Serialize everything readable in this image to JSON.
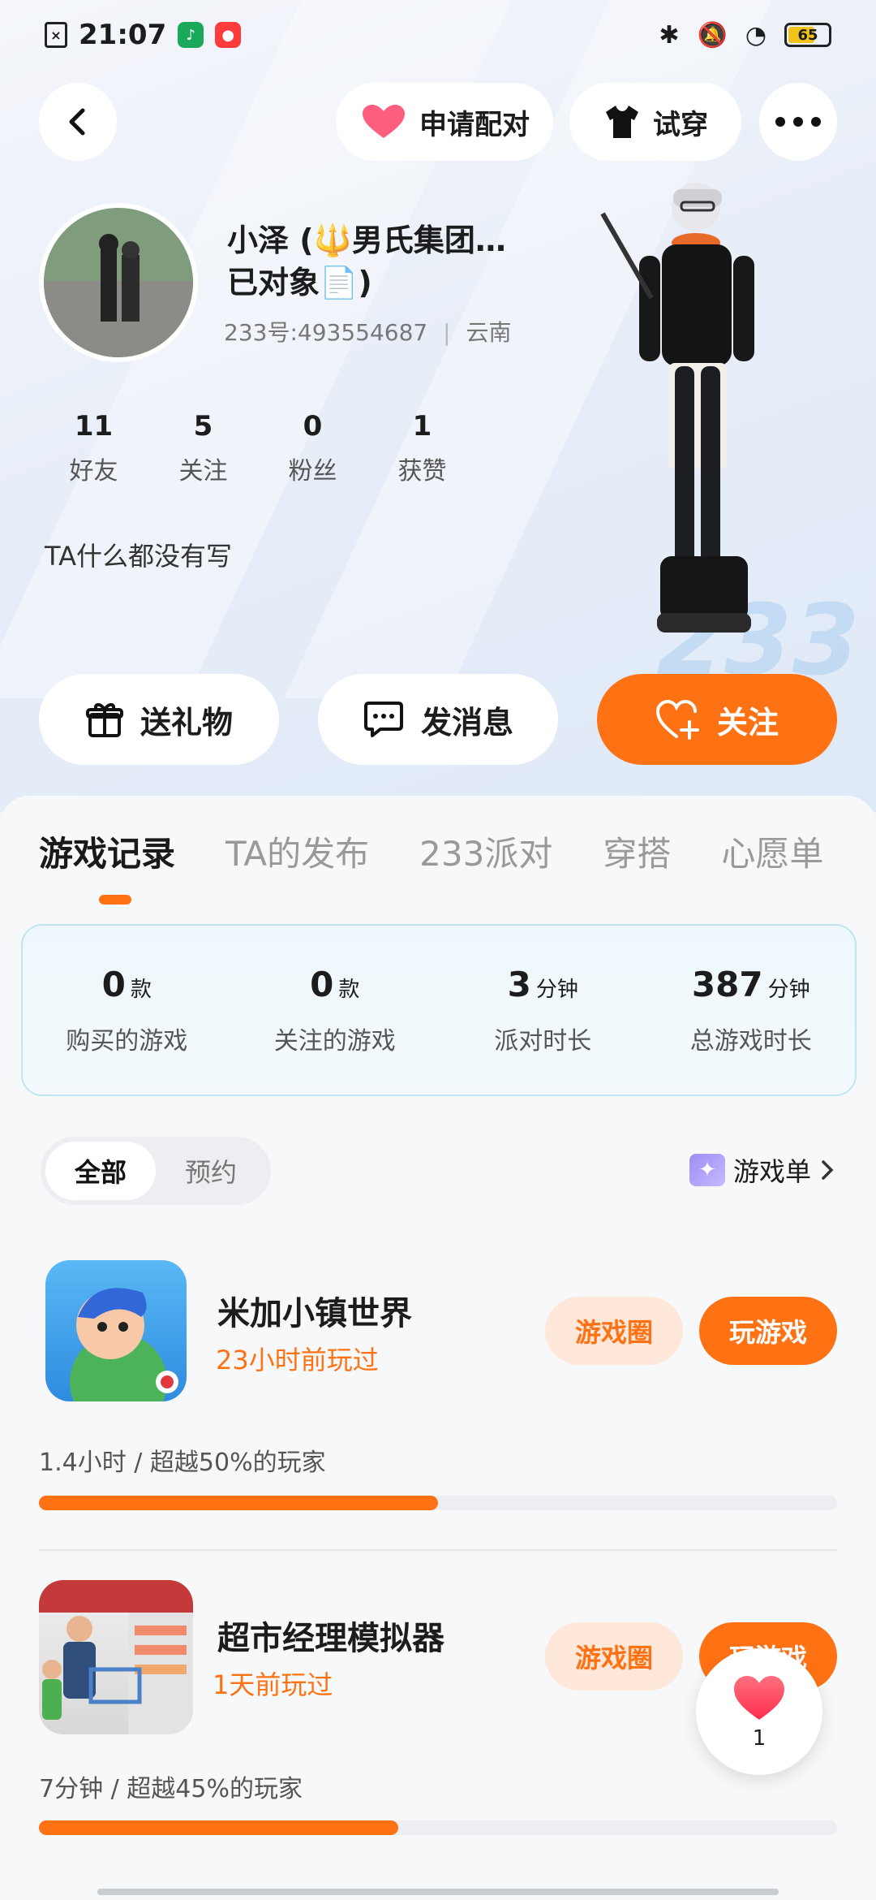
{
  "status_bar": {
    "time": "21:07",
    "battery": "65"
  },
  "top_actions": {
    "pair_label": "申请配对",
    "tryon_label": "试穿"
  },
  "profile": {
    "name_line1": "小泽 (🔱男氏集团…",
    "name_line2": "已对象📄)",
    "uid": "233号:493554687",
    "region": "云南",
    "stats": [
      {
        "value": "11",
        "label": "好友"
      },
      {
        "value": "5",
        "label": "关注"
      },
      {
        "value": "0",
        "label": "粉丝"
      },
      {
        "value": "1",
        "label": "获赞"
      }
    ],
    "bio": "TA什么都没有写"
  },
  "actions": {
    "gift_label": "送礼物",
    "message_label": "发消息",
    "follow_label": "关注"
  },
  "tabs": [
    "游戏记录",
    "TA的发布",
    "233派对",
    "穿搭",
    "心愿单"
  ],
  "summary": [
    {
      "value": "0",
      "unit": "款",
      "label": "购买的游戏"
    },
    {
      "value": "0",
      "unit": "款",
      "label": "关注的游戏"
    },
    {
      "value": "3",
      "unit": "分钟",
      "label": "派对时长"
    },
    {
      "value": "387",
      "unit": "分钟",
      "label": "总游戏时长"
    }
  ],
  "filter": {
    "all": "全部",
    "reserve": "预约"
  },
  "game_list_link": "游戏单",
  "games": [
    {
      "title": "米加小镇世界",
      "last_played": "23小时前玩过",
      "circle_label": "游戏圈",
      "play_label": "玩游戏",
      "stat": "1.4小时 / 超越50%的玩家",
      "progress": 0.5
    },
    {
      "title": "超市经理模拟器",
      "last_played": "1天前玩过",
      "circle_label": "游戏圈",
      "play_label": "玩游戏",
      "stat": "7分钟 / 超越45%的玩家",
      "progress": 0.45
    }
  ],
  "float_like": {
    "count": "1"
  },
  "colors": {
    "accent": "#ff7214",
    "accent_light": "#ffe8da",
    "summary_border": "#bfe6f0"
  }
}
